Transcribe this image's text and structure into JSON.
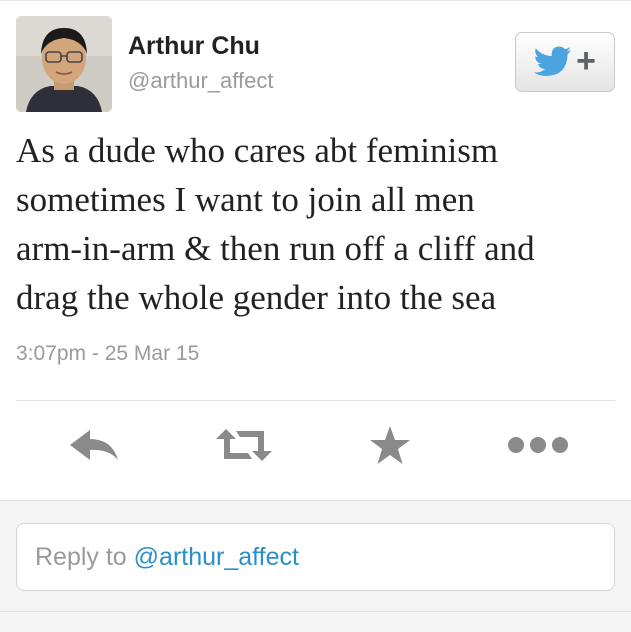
{
  "tweet": {
    "author": {
      "display_name": "Arthur Chu",
      "handle": "@arthur_affect"
    },
    "text_lines": [
      "As a dude who cares abt feminism",
      "sometimes I want to join all men",
      "arm-in-arm & then run off a cliff and",
      "drag the whole gender into the sea"
    ],
    "timestamp": "3:07pm - 25 Mar 15"
  },
  "follow_button": {
    "icon": "twitter-bird-icon",
    "plus_label": "+"
  },
  "actions": [
    {
      "name": "reply",
      "icon": "reply-arrow-icon"
    },
    {
      "name": "retweet",
      "icon": "retweet-icon"
    },
    {
      "name": "favorite",
      "icon": "star-icon"
    },
    {
      "name": "more",
      "icon": "more-dots-icon"
    }
  ],
  "reply_box": {
    "prefix": "Reply to",
    "mention": "@arthur_affect"
  },
  "colors": {
    "text": "#222222",
    "muted": "#9a9a9a",
    "link": "#2a8fc7",
    "twitter_blue": "#4ba4e0",
    "icon_gray": "#8a8a8a"
  }
}
